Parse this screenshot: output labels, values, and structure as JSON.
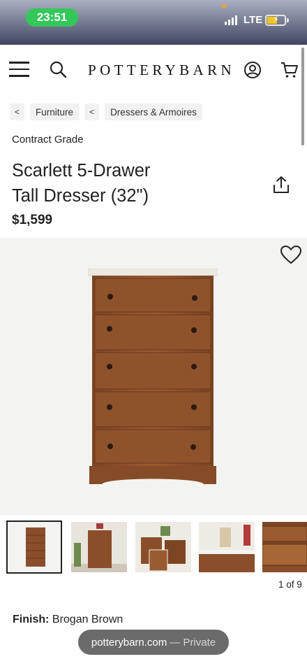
{
  "status_bar": {
    "time": "23:51",
    "network": "LTE"
  },
  "header": {
    "menu_icon": "hamburger-icon",
    "search_icon": "search-icon",
    "logo": "POTTERYBARN",
    "account_icon": "account-icon",
    "cart_icon": "cart-icon"
  },
  "breadcrumb": [
    {
      "chevron": "<",
      "label": "Furniture"
    },
    {
      "chevron": "<",
      "label": "Dressers & Armoires"
    }
  ],
  "product": {
    "grade": "Contract Grade",
    "title_line1": "Scarlett 5-Drawer",
    "title_line2": "Tall Dresser (32\")",
    "price": "$1,599",
    "share_icon": "share-icon",
    "favorite_icon": "heart-icon"
  },
  "gallery": {
    "counter": "1 of 9",
    "thumbnails": [
      "dresser-front",
      "dresser-room",
      "dresser-set",
      "dresser-detail",
      "dresser-drawer"
    ]
  },
  "finish": {
    "label": "Finish:",
    "value": "Brogan Brown"
  },
  "browser": {
    "domain": "potterybarn.com",
    "mode": "— Private"
  },
  "colors": {
    "status_green": "#34c759",
    "wood": "#8a4f2a",
    "background": "#f3f3f1"
  }
}
